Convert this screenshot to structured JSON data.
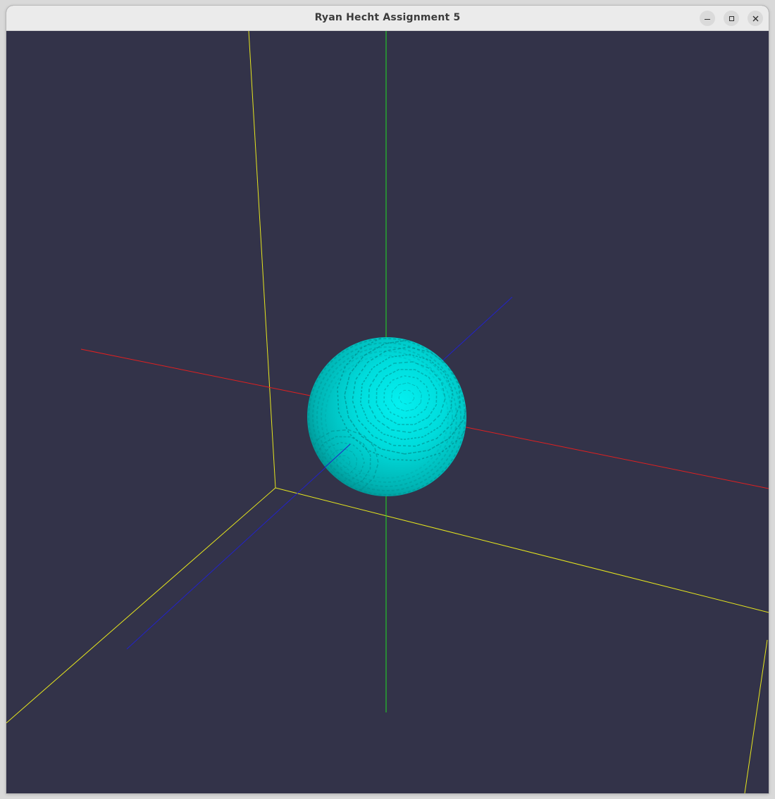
{
  "window": {
    "title": "Ryan Hecht Assignment 5"
  },
  "titlebar_buttons": [
    {
      "name": "minimize",
      "icon": "minimize-icon"
    },
    {
      "name": "maximize",
      "icon": "maximize-icon"
    },
    {
      "name": "close",
      "icon": "close-icon"
    }
  ],
  "scene": {
    "background_color": "#333349",
    "colors": {
      "x_axis": "#e02020",
      "y_axis": "#22dd22",
      "z_axis": "#2222c8",
      "bounding_box": "#e6e61e",
      "sphere": "#00d8d8",
      "sphere_highlight": "#05f0f0",
      "sphere_shadow": "#008c8c"
    }
  }
}
